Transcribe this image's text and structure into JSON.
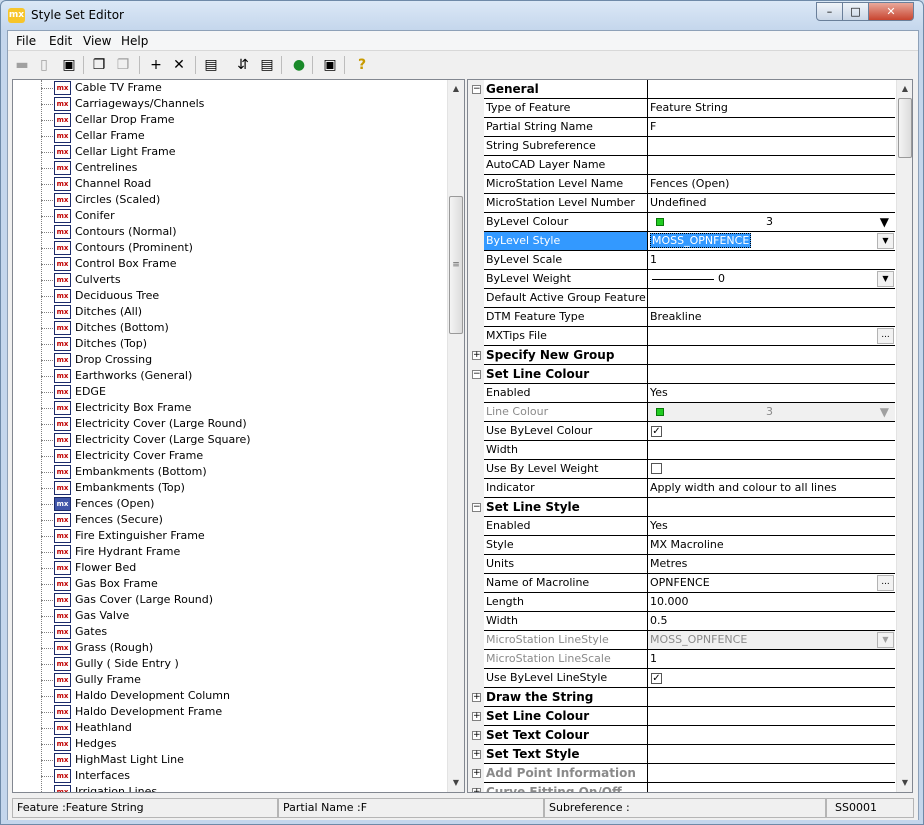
{
  "window": {
    "title": "Style Set Editor",
    "app_icon": "mx",
    "min_symbol": "–",
    "max_symbol": "□",
    "close_symbol": "✕"
  },
  "menu": [
    "File",
    "Edit",
    "View",
    "Help"
  ],
  "toolbar": [
    {
      "name": "open-folder-icon",
      "glyph": "▬",
      "disabled": true
    },
    {
      "name": "new-document-icon",
      "glyph": "▯",
      "disabled": true
    },
    {
      "name": "save-icon",
      "glyph": "▣",
      "disabled": false
    },
    {
      "name": "copy-icon",
      "glyph": "❐",
      "disabled": false
    },
    {
      "name": "paste-icon",
      "glyph": "❐",
      "disabled": true
    },
    {
      "name": "add-icon",
      "glyph": "+",
      "disabled": false
    },
    {
      "name": "delete-icon",
      "glyph": "✕",
      "disabled": false
    },
    {
      "name": "properties-icon",
      "glyph": "▤",
      "disabled": false
    },
    {
      "name": "sort-icon",
      "glyph": "⇵",
      "disabled": false
    },
    {
      "name": "list-icon",
      "glyph": "▤",
      "disabled": false
    },
    {
      "name": "globe-icon",
      "glyph": "●",
      "disabled": false
    },
    {
      "name": "monitor-icon",
      "glyph": "▣",
      "disabled": false
    },
    {
      "name": "help-icon",
      "glyph": "?",
      "disabled": false
    }
  ],
  "tree": {
    "selected": "Fences (Open)",
    "items": [
      "Cable TV Frame",
      "Carriageways/Channels",
      "Cellar Drop Frame",
      "Cellar Frame",
      "Cellar Light Frame",
      "Centrelines",
      "Channel Road",
      "Circles (Scaled)",
      "Conifer",
      "Contours (Normal)",
      "Contours (Prominent)",
      "Control Box Frame",
      "Culverts",
      "Deciduous Tree",
      "Ditches (All)",
      "Ditches (Bottom)",
      "Ditches (Top)",
      "Drop Crossing",
      "Earthworks (General)",
      "EDGE",
      "Electricity Box Frame",
      "Electricity Cover (Large Round)",
      "Electricity Cover (Large Square)",
      "Electricity Cover Frame",
      "Embankments (Bottom)",
      "Embankments (Top)",
      "Fences (Open)",
      "Fences (Secure)",
      "Fire Extinguisher Frame",
      "Fire Hydrant Frame",
      "Flower Bed",
      "Gas Box Frame",
      "Gas Cover (Large Round)",
      "Gas Valve",
      "Gates",
      "Grass (Rough)",
      "Gully ( Side Entry )",
      "Gully Frame",
      "Haldo Development Column",
      "Haldo Development Frame",
      "Heathland",
      "Hedges",
      "HighMast Light Line",
      "Interfaces",
      "Irrigation Lines"
    ]
  },
  "properties": [
    {
      "kind": "cat",
      "expander": "−",
      "name": "General",
      "value": ""
    },
    {
      "kind": "prop",
      "name": "Type of Feature",
      "value": "Feature String"
    },
    {
      "kind": "prop",
      "name": "Partial String Name",
      "value": "F"
    },
    {
      "kind": "prop",
      "name": "String Subreference",
      "value": ""
    },
    {
      "kind": "prop",
      "name": "AutoCAD Layer Name",
      "value": ""
    },
    {
      "kind": "prop",
      "name": "MicroStation Level Name",
      "value": "Fences (Open)"
    },
    {
      "kind": "prop",
      "name": "MicroStation Level Number",
      "value": "Undefined"
    },
    {
      "kind": "colour",
      "name": "ByLevel Colour",
      "value": "3",
      "arrow": "▼"
    },
    {
      "kind": "select",
      "name": "ByLevel Style",
      "value": "MOSS_OPNFENCE",
      "selected": true
    },
    {
      "kind": "prop",
      "name": "ByLevel Scale",
      "value": "1"
    },
    {
      "kind": "weight",
      "name": "ByLevel Weight",
      "value": "0"
    },
    {
      "kind": "prop",
      "name": "Default Active Group Feature",
      "value": ""
    },
    {
      "kind": "prop",
      "name": "DTM Feature Type",
      "value": "Breakline"
    },
    {
      "kind": "ellipsis",
      "name": "MXTips File",
      "value": ""
    },
    {
      "kind": "cat",
      "expander": "+",
      "name": "Specify New Group",
      "value": ""
    },
    {
      "kind": "cat",
      "expander": "−",
      "name": "Set Line Colour",
      "value": ""
    },
    {
      "kind": "prop",
      "name": "Enabled",
      "value": "Yes"
    },
    {
      "kind": "colour",
      "name": "Line Colour",
      "value": "3",
      "dim": true,
      "arrow": "▼"
    },
    {
      "kind": "check",
      "name": "Use ByLevel Colour",
      "value": "✓"
    },
    {
      "kind": "prop",
      "name": "Width",
      "value": ""
    },
    {
      "kind": "check",
      "name": "Use By Level Weight",
      "value": ""
    },
    {
      "kind": "prop",
      "name": "Indicator",
      "value": "Apply width and colour to all lines"
    },
    {
      "kind": "cat",
      "expander": "−",
      "name": "Set Line Style",
      "value": ""
    },
    {
      "kind": "prop",
      "name": "Enabled",
      "value": "Yes"
    },
    {
      "kind": "prop",
      "name": "Style",
      "value": "MX Macroline"
    },
    {
      "kind": "prop",
      "name": "Units",
      "value": "Metres"
    },
    {
      "kind": "ellipsis",
      "name": "Name of Macroline",
      "value": "OPNFENCE"
    },
    {
      "kind": "prop",
      "name": "Length",
      "value": "10.000"
    },
    {
      "kind": "prop",
      "name": "Width",
      "value": "0.5"
    },
    {
      "kind": "select",
      "name": "MicroStation LineStyle",
      "value": "MOSS_OPNFENCE",
      "dim": true
    },
    {
      "kind": "prop",
      "name": "MicroStation LineScale",
      "value": "1",
      "dimname": true
    },
    {
      "kind": "check",
      "name": "Use ByLevel LineStyle",
      "value": "✓"
    },
    {
      "kind": "cat",
      "expander": "+",
      "name": "Draw the String",
      "value": ""
    },
    {
      "kind": "cat",
      "expander": "+",
      "name": "Set Line Colour",
      "value": ""
    },
    {
      "kind": "cat",
      "expander": "+",
      "name": "Set Text Colour",
      "value": ""
    },
    {
      "kind": "cat",
      "expander": "+",
      "name": "Set Text Style",
      "value": ""
    },
    {
      "kind": "cat",
      "expander": "+",
      "name": "Add Point Information",
      "value": "",
      "dim": true
    },
    {
      "kind": "cat",
      "expander": "+",
      "name": "Curve Fitting On/Off",
      "value": "",
      "dim": true
    }
  ],
  "status": {
    "feature": "Feature :Feature String",
    "partial": "Partial Name :F",
    "subref": "Subreference :",
    "code": "SS0001"
  },
  "scroll_arrows": {
    "up": "▲",
    "down": "▼",
    "grip": "≡"
  },
  "colors": {
    "selection": "#3399ff",
    "swatch": "#22cc22"
  }
}
